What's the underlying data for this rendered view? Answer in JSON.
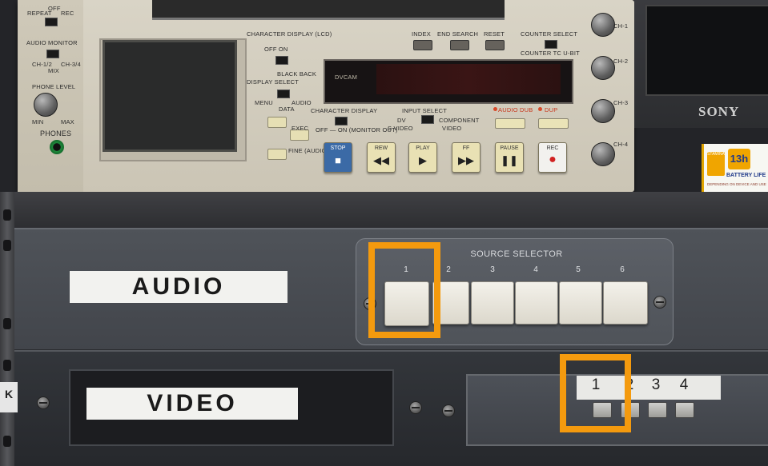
{
  "deck": {
    "repeat": "REPEAT",
    "off": "OFF",
    "rec": "REC",
    "audio_monitor": "AUDIO MONITOR",
    "ch12": "CH-1/2",
    "mix": "MIX",
    "ch34": "CH-3/4",
    "phone_level": "PHONE LEVEL",
    "min": "MIN",
    "max": "MAX",
    "phones": "PHONES",
    "character_display_lcd": "CHARACTER DISPLAY (LCD)",
    "off_on": "OFF  ON",
    "black_back": "BLACK BACK",
    "display_select": "DISPLAY SELECT",
    "menu": "MENU",
    "audio": "AUDIO",
    "data": "DATA",
    "exec": "EXEC",
    "fine_audio": "FINE (AUDIO)",
    "character_display": "CHARACTER DISPLAY",
    "monitor_out": "OFF — ON (MONITOR OUT)",
    "index": "INDEX",
    "end_search": "END SEARCH",
    "reset": "RESET",
    "counter_select": "COUNTER SELECT",
    "counter_opts": "COUNTER  TC  U-BIT",
    "dvcam": "DVCAM",
    "input_select": "INPUT SELECT",
    "dv": "DV",
    "component": "COMPONENT",
    "s_video": "S VIDEO",
    "video": "VIDEO",
    "audio_dub": "AUDIO DUB",
    "dup": "DUP",
    "stop": "STOP",
    "rew": "REW",
    "play": "PLAY",
    "ff": "FF",
    "pause": "PAUSE",
    "rec_btn": "REC",
    "ch_labels": [
      "CH-1",
      "CH-2",
      "CH-3",
      "CH-4"
    ]
  },
  "monitor": {
    "brand": "SONY"
  },
  "battery": {
    "brand": "STAMINA",
    "hours": "13h",
    "text": "BATTERY LIFE",
    "fine": "DEPENDING ON DEVICE AND USE"
  },
  "audio_panel": {
    "label": "AUDIO",
    "title": "SOURCE SELECTOR",
    "buttons": [
      "1",
      "2",
      "3",
      "4",
      "5",
      "6"
    ]
  },
  "video_panel": {
    "label": "VIDEO",
    "brand": "K",
    "buttons": [
      "1",
      "2",
      "3",
      "4"
    ]
  },
  "highlights": {
    "color": "#f49a0e"
  }
}
